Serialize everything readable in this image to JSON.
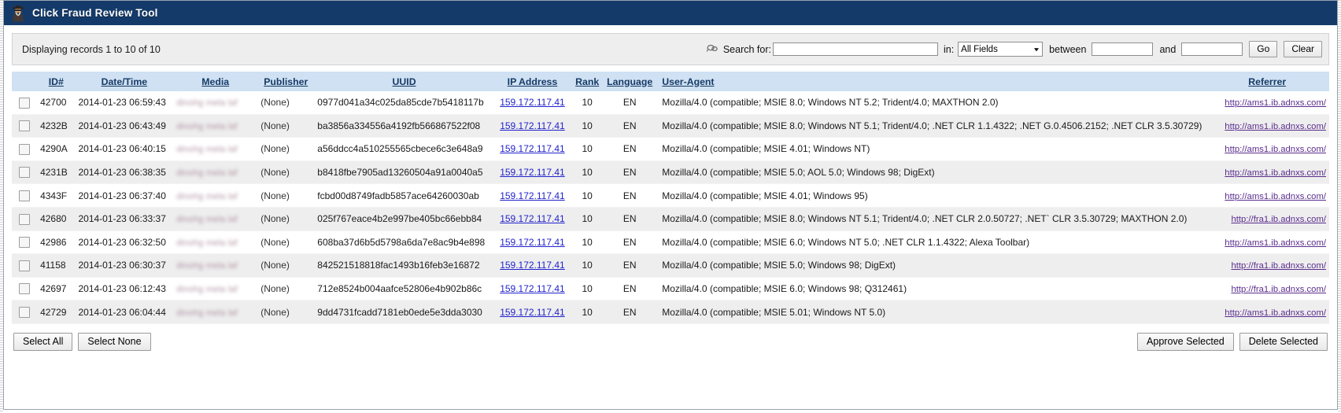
{
  "window": {
    "title": "Click Fraud Review Tool",
    "icon": "detective-icon",
    "titlebar_color": "#143a6a"
  },
  "toolbar": {
    "status_text": "Displaying records 1 to 10 of 10",
    "search_icon": "magnifier-icon",
    "search_label": "Search for:",
    "search_value": "",
    "search_placeholder": "",
    "in_label": "in:",
    "field_selected": "All Fields",
    "field_options": [
      "All Fields"
    ],
    "between_label": "between",
    "between_value": "",
    "and_label": "and",
    "and_value": "",
    "go_label": "Go",
    "clear_label": "Clear"
  },
  "table": {
    "columns": [
      {
        "key": "check",
        "label": ""
      },
      {
        "key": "id",
        "label": "ID#"
      },
      {
        "key": "date",
        "label": "Date/Time"
      },
      {
        "key": "media",
        "label": "Media"
      },
      {
        "key": "publisher",
        "label": "Publisher"
      },
      {
        "key": "uuid",
        "label": "UUID"
      },
      {
        "key": "ip",
        "label": "IP Address"
      },
      {
        "key": "rank",
        "label": "Rank"
      },
      {
        "key": "language",
        "label": "Language"
      },
      {
        "key": "useragent",
        "label": "User-Agent"
      },
      {
        "key": "referrer",
        "label": "Referrer"
      }
    ],
    "rows": [
      {
        "checked": false,
        "id": "42700",
        "date": "2014-01-23 06:59:43",
        "media": "dinohg mela laf",
        "media_redacted": true,
        "publisher": "(None)",
        "uuid": "0977d041a34c025da85cde7b5418117b",
        "ip": "159.172.117.41",
        "rank": "10",
        "language": "EN",
        "useragent": "Mozilla/4.0 (compatible; MSIE 8.0; Windows NT 5.2; Trident/4.0; MAXTHON 2.0)",
        "referrer": "http://ams1.ib.adnxs.com/"
      },
      {
        "checked": false,
        "id": "4232B",
        "date": "2014-01-23 06:43:49",
        "media": "dinohg mela laf",
        "media_redacted": true,
        "publisher": "(None)",
        "uuid": "ba3856a334556a4192fb566867522f08",
        "ip": "159.172.117.41",
        "rank": "10",
        "language": "EN",
        "useragent": "Mozilla/4.0 (compatible; MSIE 8.0; Windows NT 5.1; Trident/4.0; .NET CLR 1.1.4322; .NET G.0.4506.2152; .NET CLR 3.5.30729)",
        "referrer": "http://ams1.ib.adnxs.com/"
      },
      {
        "checked": false,
        "id": "4290A",
        "date": "2014-01-23 06:40:15",
        "media": "dinohg mela laf",
        "media_redacted": true,
        "publisher": "(None)",
        "uuid": "a56ddcc4a510255565cbece6c3e648a9",
        "ip": "159.172.117.41",
        "rank": "10",
        "language": "EN",
        "useragent": "Mozilla/4.0 (compatible; MSIE 4.01; Windows NT)",
        "referrer": "http://ams1.ib.adnxs.com/"
      },
      {
        "checked": false,
        "id": "4231B",
        "date": "2014-01-23 06:38:35",
        "media": "dinohg mela laf",
        "media_redacted": true,
        "publisher": "(None)",
        "uuid": "b8418fbe7905ad13260504a91a0040a5",
        "ip": "159.172.117.41",
        "rank": "10",
        "language": "EN",
        "useragent": "Mozilla/4.0 (compatible; MSIE 5.0; AOL 5.0; Windows 98; DigExt)",
        "referrer": "http://ams1.ib.adnxs.com/"
      },
      {
        "checked": false,
        "id": "4343F",
        "date": "2014-01-23 06:37:40",
        "media": "dinohg mela laf",
        "media_redacted": true,
        "publisher": "(None)",
        "uuid": "fcbd00d8749fadb5857ace64260030ab",
        "ip": "159.172.117.41",
        "rank": "10",
        "language": "EN",
        "useragent": "Mozilla/4.0 (compatible; MSIE 4.01; Windows 95)",
        "referrer": "http://ams1.ib.adnxs.com/"
      },
      {
        "checked": false,
        "id": "42680",
        "date": "2014-01-23 06:33:37",
        "media": "dinohg mela laf",
        "media_redacted": true,
        "publisher": "(None)",
        "uuid": "025f767eace4b2e997be405bc66ebb84",
        "ip": "159.172.117.41",
        "rank": "10",
        "language": "EN",
        "useragent": "Mozilla/4.0 (compatible; MSIE 8.0; Windows NT 5.1; Trident/4.0; .NET CLR 2.0.50727; .NET` CLR 3.5.30729; MAXTHON 2.0)",
        "referrer": "http://fra1.ib.adnxs.com/"
      },
      {
        "checked": false,
        "id": "42986",
        "date": "2014-01-23 06:32:50",
        "media": "dinohg mela laf",
        "media_redacted": true,
        "publisher": "(None)",
        "uuid": "608ba37d6b5d5798a6da7e8ac9b4e898",
        "ip": "159.172.117.41",
        "rank": "10",
        "language": "EN",
        "useragent": "Mozilla/4.0 (compatible; MSIE 6.0; Windows NT 5.0; .NET CLR 1.1.4322; Alexa Toolbar)",
        "referrer": "http://ams1.ib.adnxs.com/"
      },
      {
        "checked": false,
        "id": "41158",
        "date": "2014-01-23 06:30:37",
        "media": "dinohg mela laf",
        "media_redacted": true,
        "publisher": "(None)",
        "uuid": "842521518818fac1493b16feb3e16872",
        "ip": "159.172.117.41",
        "rank": "10",
        "language": "EN",
        "useragent": "Mozilla/4.0 (compatible; MSIE 5.0; Windows 98; DigExt)",
        "referrer": "http://fra1.ib.adnxs.com/"
      },
      {
        "checked": false,
        "id": "42697",
        "date": "2014-01-23 06:12:43",
        "media": "dinohg mela laf",
        "media_redacted": true,
        "publisher": "(None)",
        "uuid": "712e8524b004aafce52806e4b902b86c",
        "ip": "159.172.117.41",
        "rank": "10",
        "language": "EN",
        "useragent": "Mozilla/4.0 (compatible; MSIE 6.0; Windows 98; Q312461)",
        "referrer": "http://fra1.ib.adnxs.com/"
      },
      {
        "checked": false,
        "id": "42729",
        "date": "2014-01-23 06:04:44",
        "media": "dinohg mela laf",
        "media_redacted": true,
        "publisher": "(None)",
        "uuid": "9dd4731fcadd7181eb0ede5e3dda3030",
        "ip": "159.172.117.41",
        "rank": "10",
        "language": "EN",
        "useragent": "Mozilla/4.0 (compatible; MSIE 5.01; Windows NT 5.0)",
        "referrer": "http://ams1.ib.adnxs.com/"
      }
    ]
  },
  "footer": {
    "select_all_label": "Select All",
    "select_none_label": "Select None",
    "approve_label": "Approve Selected",
    "delete_label": "Delete Selected"
  }
}
